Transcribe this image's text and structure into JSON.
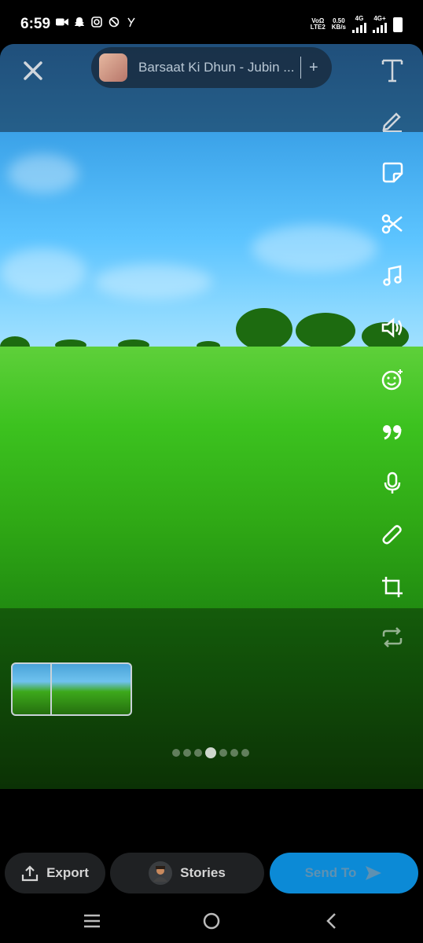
{
  "status_bar": {
    "time": "6:59",
    "net_speed": "0.50",
    "net_speed_unit": "KB/s",
    "volte_top": "VoΩ",
    "volte_bottom": "LTE2",
    "sim1_type": "4G",
    "sim2_type": "4G+"
  },
  "editor": {
    "song_title": "Barsaat Ki Dhun - Jubin ...",
    "song_add": "+"
  },
  "toolbar": {
    "tools": [
      "text-icon",
      "pencil-icon",
      "sticker-icon",
      "scissors-icon",
      "music-icon",
      "volume-icon",
      "emoji-icon",
      "quote-icon",
      "mic-icon",
      "paperclip-icon",
      "crop-icon",
      "loop-icon"
    ]
  },
  "pagination": {
    "current": 4,
    "total": 7
  },
  "actions": {
    "export_label": "Export",
    "stories_label": "Stories",
    "send_label": "Send To"
  },
  "colors": {
    "send_button": "#0c8ad6",
    "dark_button": "#1f2123"
  }
}
